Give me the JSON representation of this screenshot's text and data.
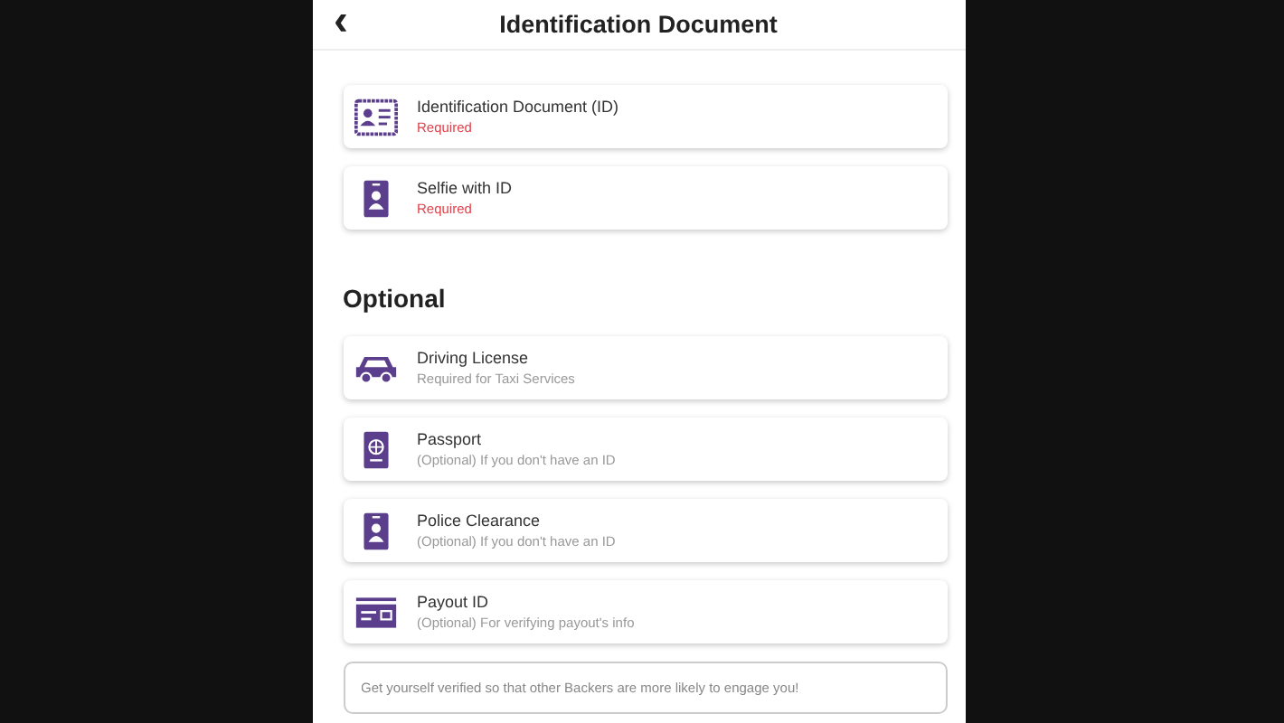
{
  "header": {
    "back": "‹",
    "title": "Identification Document"
  },
  "required_items": [
    {
      "kind": "id-card",
      "title": "Identification Document (ID)",
      "subtitle": "Required",
      "required": true
    },
    {
      "kind": "person-badge",
      "title": "Selfie with ID",
      "subtitle": "Required",
      "required": true
    }
  ],
  "optional_heading": "Optional",
  "optional_items": [
    {
      "kind": "car",
      "title": "Driving License",
      "subtitle": "Required for Taxi Services",
      "required": false
    },
    {
      "kind": "passport",
      "title": "Passport",
      "subtitle": "(Optional) If you don't have an ID",
      "required": false
    },
    {
      "kind": "person-badge",
      "title": "Police Clearance",
      "subtitle": "(Optional) If you don't have an ID",
      "required": false
    },
    {
      "kind": "payout-card",
      "title": "Payout ID",
      "subtitle": "(Optional) For verifying payout's info",
      "required": false
    }
  ],
  "note": {
    "placeholder": "Get yourself verified so that other Backers are more likely to engage you!"
  }
}
